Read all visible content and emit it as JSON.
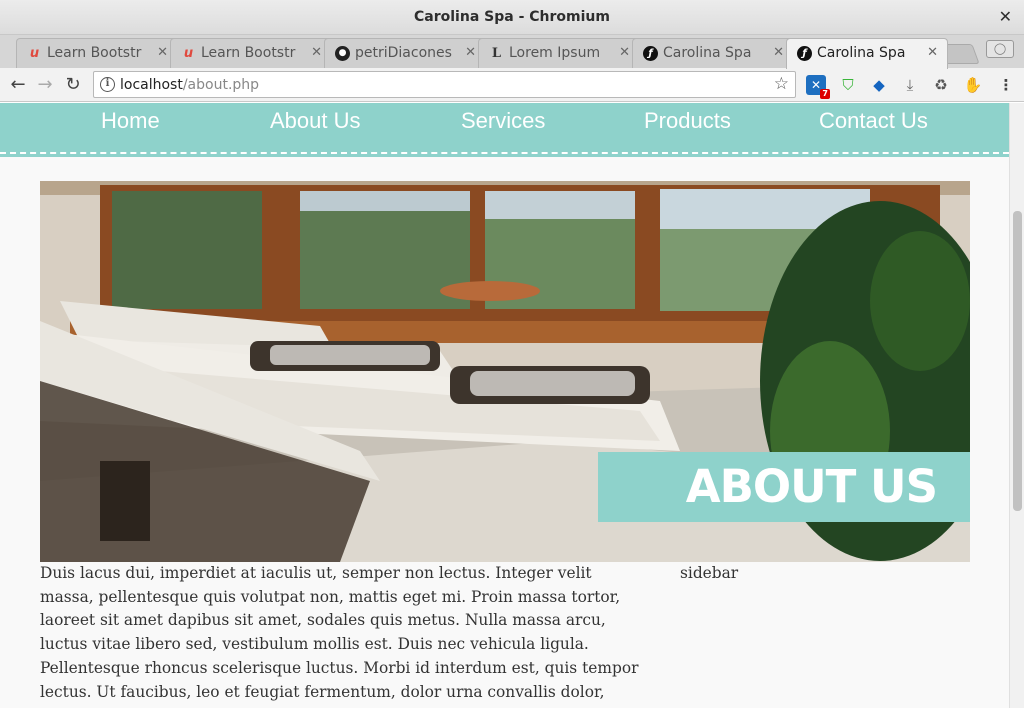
{
  "window": {
    "title": "Carolina Spa - Chromium",
    "close_glyph": "✕"
  },
  "tabs": [
    {
      "label": "Learn Bootstr",
      "icon": "udemy-icon"
    },
    {
      "label": "Learn Bootstr",
      "icon": "udemy-icon"
    },
    {
      "label": "petriDiacones",
      "icon": "github-icon"
    },
    {
      "label": "Lorem Ipsum",
      "icon": "lipsum-icon"
    },
    {
      "label": "Carolina Spa",
      "icon": "symfony-icon"
    },
    {
      "label": "Carolina Spa",
      "icon": "symfony-icon",
      "active": true
    }
  ],
  "toolbar": {
    "url_host": "localhost",
    "url_path": "/about.php",
    "extension_badge": "7"
  },
  "site": {
    "nav": [
      "Home",
      "About Us",
      "Services",
      "Products",
      "Contact Us"
    ],
    "hero_title": "ABOUT US",
    "body_text": "Duis lacus dui, imperdiet at iaculis ut, semper non lectus. Integer velit massa, pellentesque quis volutpat non, mattis eget mi. Proin massa tortor, laoreet sit amet dapibus sit amet, sodales quis metus. Nulla massa arcu, luctus vitae libero sed, vestibulum mollis est. Duis nec vehicula ligula. Pellentesque rhoncus scelerisque luctus. Morbi id interdum est, quis tempor lectus. Ut faucibus, leo et feugiat fermentum, dolor urna convallis dolor, vitae fringilla sem odio ut erat. Lorem ipsum",
    "sidebar": "sidebar"
  },
  "colors": {
    "accent": "#8ed2cb"
  }
}
